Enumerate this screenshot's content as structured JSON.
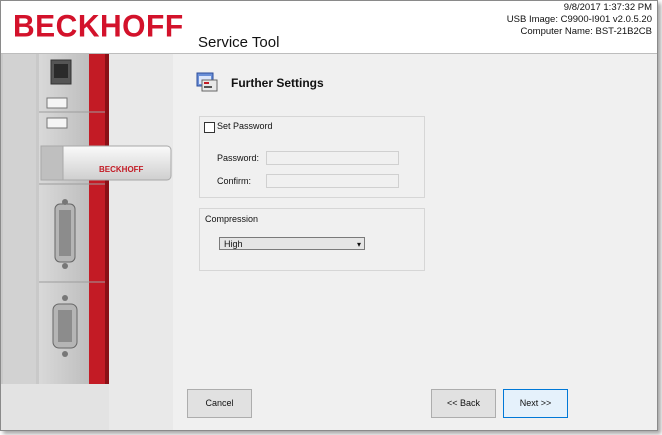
{
  "header": {
    "brand": "BECKHOFF",
    "title": "Service Tool",
    "datetime": "9/8/2017 1:37:32 PM",
    "usb_image": "USB Image: C9900-I901 v2.0.5.20",
    "computer_name": "Computer Name: BST-21B2CB"
  },
  "device_image": {
    "usb_stick_brand": "BECKHOFF"
  },
  "section": {
    "title": "Further Settings",
    "icon": "settings-window-icon"
  },
  "password_group": {
    "checkbox_label": "Set Password",
    "checked": false,
    "password_label": "Password:",
    "password_value": "",
    "confirm_label": "Confirm:",
    "confirm_value": ""
  },
  "compression_group": {
    "label": "Compression",
    "selected": "High"
  },
  "buttons": {
    "cancel": "Cancel",
    "back": "<< Back",
    "next": "Next >>"
  },
  "colors": {
    "brand_red": "#d3122b",
    "panel_bg": "#f0f0f0",
    "focus_border": "#0078d7"
  }
}
